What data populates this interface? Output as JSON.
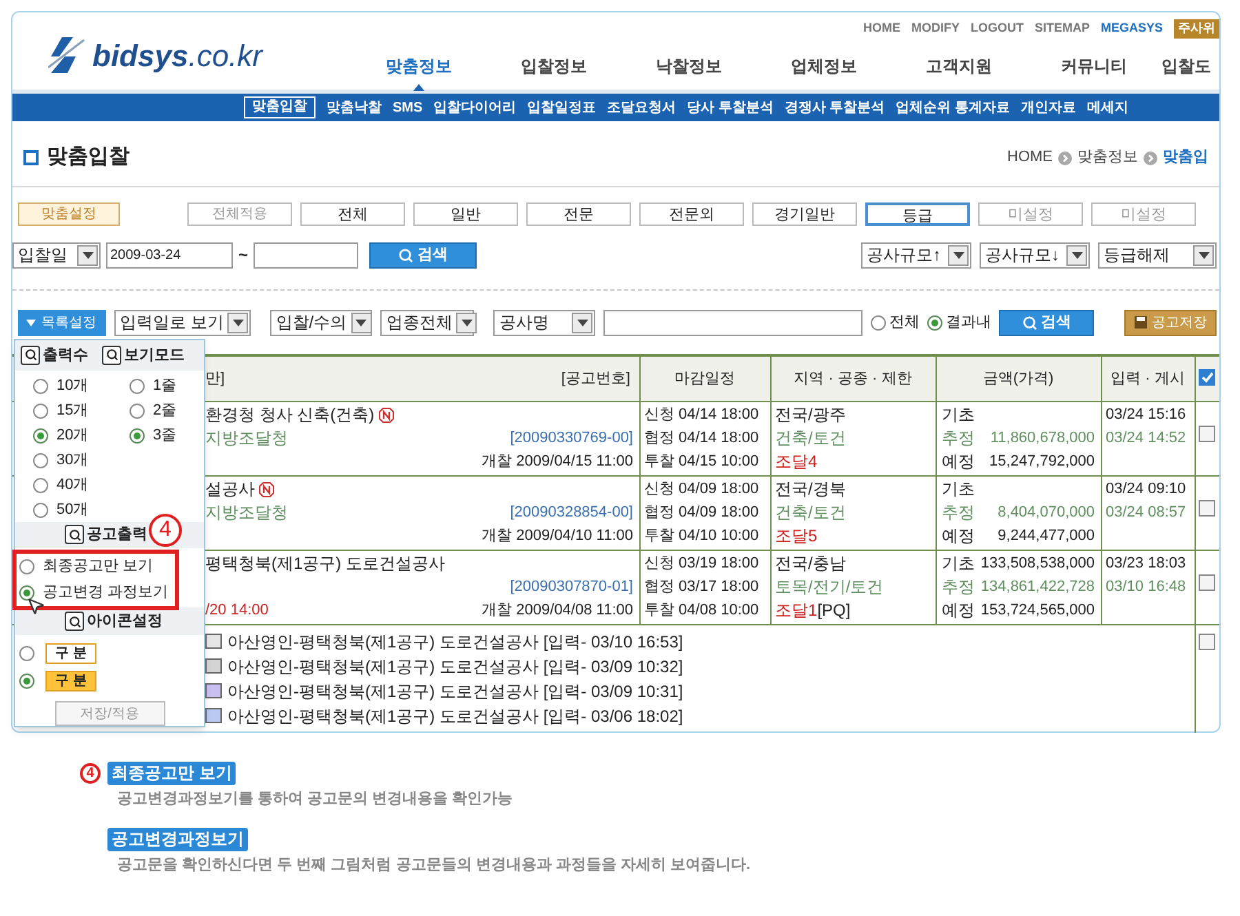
{
  "header": {
    "logo": "**bidsys**.co.kr",
    "top_links": [
      {
        "label": "HOME",
        "highlight": false
      },
      {
        "label": "MODIFY",
        "highlight": false
      },
      {
        "label": "LOGOUT",
        "highlight": false
      },
      {
        "label": "SITEMAP",
        "highlight": false
      },
      {
        "label": "MEGASYS",
        "highlight": true
      }
    ],
    "top_badge": "주사위",
    "main_nav": [
      {
        "label": "맞춤정보",
        "selected": true
      },
      {
        "label": "입찰정보",
        "selected": false
      },
      {
        "label": "낙찰정보",
        "selected": false
      },
      {
        "label": "업체정보",
        "selected": false
      },
      {
        "label": "고객지원",
        "selected": false
      },
      {
        "label": "커뮤니티",
        "selected": false
      },
      {
        "label": "입찰도",
        "selected": false
      }
    ]
  },
  "sub_nav": [
    {
      "label": "맞춤입찰",
      "selected": true
    },
    {
      "label": "맞춤낙찰",
      "selected": false
    },
    {
      "label": "SMS",
      "selected": false
    },
    {
      "label": "입찰다이어리",
      "selected": false
    },
    {
      "label": "입찰일정표",
      "selected": false
    },
    {
      "label": "조달요청서",
      "selected": false
    },
    {
      "label": "당사 투찰분석",
      "selected": false
    },
    {
      "label": "경쟁사 투찰분석",
      "selected": false
    },
    {
      "label": "업체순위 통계자료",
      "selected": false
    },
    {
      "label": "개인자료",
      "selected": false
    },
    {
      "label": "메세지",
      "selected": false
    }
  ],
  "page_title": "맞춤입찰",
  "breadcrumb": [
    "HOME",
    "맞춤정보",
    "맞춤입"
  ],
  "preset_button": "맞춤설정",
  "apply_all_button": "전체적용",
  "grade_tabs": [
    {
      "label": "전체",
      "selected": false,
      "disabled": false
    },
    {
      "label": "일반",
      "selected": false,
      "disabled": false
    },
    {
      "label": "전문",
      "selected": false,
      "disabled": false
    },
    {
      "label": "전문외",
      "selected": false,
      "disabled": false
    },
    {
      "label": "경기일반",
      "selected": false,
      "disabled": false
    },
    {
      "label": "등급",
      "selected": true,
      "disabled": false
    },
    {
      "label": "미설정",
      "selected": false,
      "disabled": true
    },
    {
      "label": "미설정",
      "selected": false,
      "disabled": true
    }
  ],
  "date_filter": {
    "field": "입찰일",
    "from": "2009-03-24",
    "separator": "~",
    "search": "검색"
  },
  "sort_selects": [
    "공사규모↑",
    "공사규모↓",
    "등급해제"
  ],
  "list_toolbar": {
    "settings_button": "목록설정",
    "view_select": "입력일로 보기",
    "type_select": "입찰/수의",
    "industry_select": "업종전체",
    "field_select": "공사명",
    "scope": [
      {
        "label": "전체",
        "selected": false
      },
      {
        "label": "결과내",
        "selected": true
      }
    ],
    "search": "검색",
    "save": "공고저장"
  },
  "table": {
    "columns": [
      "만]",
      "[공고번호]",
      "마감일정",
      "지역 · 공종 · 제한",
      "금액(가격)",
      "입력 · 게시"
    ],
    "select_all_checked": true,
    "rows": [
      {
        "title": "환경청 청사 신축(건축)",
        "new": true,
        "agency": "지방조달청",
        "number": "[20090330769-00]",
        "opening": "개찰 2009/04/15 11:00",
        "deadlines": [
          "신청 04/14 18:00",
          "협정 04/14 18:00",
          "투찰 04/15 10:00"
        ],
        "region": [
          {
            "text": "전국/광주",
            "color": "#222222"
          },
          {
            "text": "건축/토건",
            "color": "#5f8f5f"
          },
          {
            "text": "조달4",
            "color": "#cc2222"
          }
        ],
        "amounts": [
          {
            "label": "기초",
            "color": "#222222"
          },
          {
            "label": "추정",
            "value": "11,860,678,000",
            "color": "#5f8f5f"
          },
          {
            "label": "예정",
            "value": "15,247,792,000",
            "color": "#222222"
          }
        ],
        "posted": [
          {
            "text": "03/24 15:16",
            "color": "#222222"
          },
          {
            "text": "03/24 14:52",
            "color": "#5f8f5f"
          }
        ],
        "checked": false
      },
      {
        "title": "설공사",
        "new": true,
        "agency": "지방조달청",
        "number": "[20090328854-00]",
        "opening": "개찰 2009/04/10 11:00",
        "deadlines": [
          "신청 04/09 18:00",
          "협정 04/09 18:00",
          "투찰 04/10 10:00"
        ],
        "region": [
          {
            "text": "전국/경북",
            "color": "#222222"
          },
          {
            "text": "건축/토건",
            "color": "#5f8f5f"
          },
          {
            "text": "조달5",
            "color": "#cc2222"
          }
        ],
        "amounts": [
          {
            "label": "기초",
            "color": "#222222"
          },
          {
            "label": "추정",
            "value": "8,404,070,000",
            "color": "#5f8f5f"
          },
          {
            "label": "예정",
            "value": "9,244,477,000",
            "color": "#222222"
          }
        ],
        "posted": [
          {
            "text": "03/24 09:10",
            "color": "#222222"
          },
          {
            "text": "03/24 08:57",
            "color": "#5f8f5f"
          }
        ],
        "checked": false
      },
      {
        "title": "평택청북(제1공구) 도로건설공사",
        "new": false,
        "number": "[20090307870-01]",
        "deadline_note": "/20 14:00",
        "opening": "개찰 2009/04/08 11:00",
        "deadlines": [
          "신청 03/19 18:00",
          "협정 03/17 18:00",
          "투찰 04/08 10:00"
        ],
        "region": [
          {
            "text": "전국/충남",
            "color": "#222222"
          },
          {
            "text": "토목/전기/토건",
            "color": "#5f8f5f"
          },
          {
            "text": "조달1",
            "color": "#cc2222",
            "note": "[PQ]"
          }
        ],
        "amounts": [
          {
            "label": "기초",
            "value": "133,508,538,000",
            "color": "#222222"
          },
          {
            "label": "추정",
            "value": "134,861,422,728",
            "color": "#5f8f5f"
          },
          {
            "label": "예정",
            "value": "153,724,565,000",
            "color": "#222222"
          }
        ],
        "posted": [
          {
            "text": "03/23 18:03",
            "color": "#222222"
          },
          {
            "text": "03/10 16:48",
            "color": "#5f8f5f"
          }
        ],
        "checked": false
      }
    ],
    "history": {
      "checked": false,
      "entries": [
        {
          "text": "아산영인-평택청북(제1공구) 도로건설공사 [입력- 03/10 16:53]",
          "color": "#e6e6e6"
        },
        {
          "text": "아산영인-평택청북(제1공구) 도로건설공사 [입력- 03/09 10:32]",
          "color": "#d4d4d4"
        },
        {
          "text": "아산영인-평택청북(제1공구) 도로건설공사 [입력- 03/09 10:31]",
          "color": "#c9bff0"
        },
        {
          "text": "아산영인-평택청북(제1공구) 도로건설공사 [입력- 03/06 18:02]",
          "color": "#b9c9f2"
        }
      ]
    }
  },
  "settings_panel": {
    "count_title": "출력수",
    "mode_title": "보기모드",
    "counts": [
      {
        "label": "10개",
        "selected": false
      },
      {
        "label": "15개",
        "selected": false
      },
      {
        "label": "20개",
        "selected": true
      },
      {
        "label": "30개",
        "selected": false
      },
      {
        "label": "40개",
        "selected": false
      },
      {
        "label": "50개",
        "selected": false
      }
    ],
    "modes": [
      {
        "label": "1줄",
        "selected": false
      },
      {
        "label": "2줄",
        "selected": false
      },
      {
        "label": "3줄",
        "selected": true
      }
    ],
    "output_title": "공고출력",
    "output_options": [
      {
        "label": "최종공고만 보기",
        "selected": false
      },
      {
        "label": "공고변경 과정보기",
        "selected": true
      }
    ],
    "icon_title": "아이콘설정",
    "icon_options": [
      {
        "label": "구 분",
        "selected": false,
        "filled": false
      },
      {
        "label": "구 분",
        "selected": true,
        "filled": true
      }
    ],
    "apply_button": "저장/적용"
  },
  "annotation_marker": "4",
  "notes": {
    "marker": "4",
    "items": [
      {
        "title": "최종공고만 보기",
        "text": "공고변경과정보기를 통하여 공고문의 변경내용을 확인가능"
      },
      {
        "title": "공고변경과정보기",
        "text": "공고문을 확인하신다면 두 번째 그림처럼 공고문들의 변경내용과 과정들을 자세히 보여줍니다."
      }
    ]
  }
}
